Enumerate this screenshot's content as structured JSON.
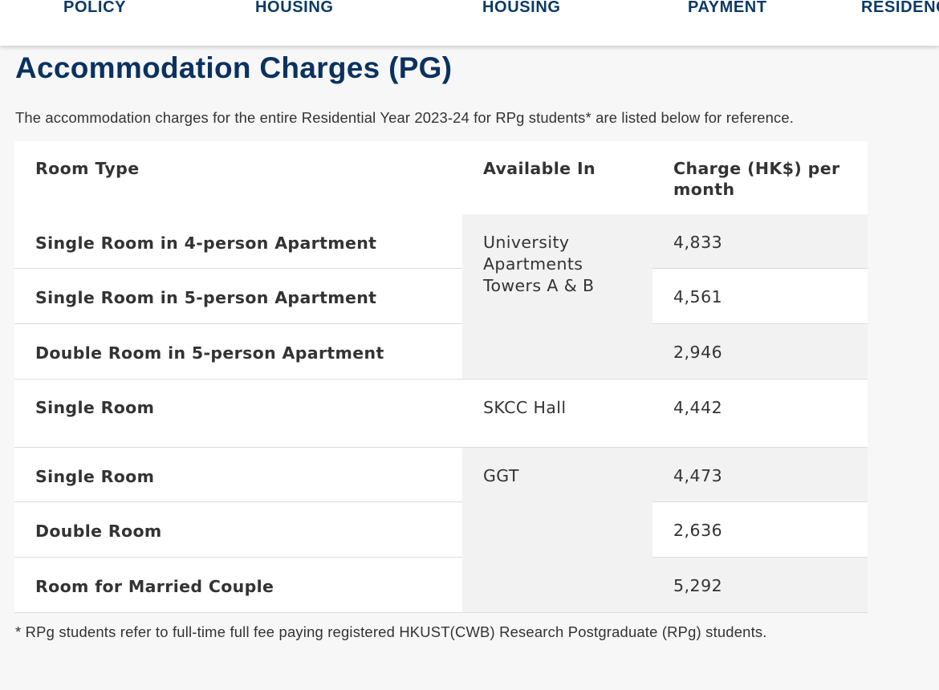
{
  "nav": {
    "items": [
      "POLICY",
      "HOUSING",
      "HOUSING",
      "PAYMENT",
      "RESIDENC"
    ]
  },
  "page": {
    "title": "Accommodation Charges (PG)",
    "intro": "The accommodation charges for the entire Residential Year 2023-24 for RPg students* are listed below for reference.",
    "footnote": "* RPg students refer to full-time full fee paying registered HKUST(CWB) Research Postgraduate (RPg) students."
  },
  "table": {
    "headers": {
      "room_type": "Room Type",
      "available_in": "Available In",
      "charge_line1": "Charge (HK$) per",
      "charge_line2": "month"
    },
    "groups": [
      {
        "location_lines": [
          "University",
          "Apartments",
          "Towers A & B"
        ],
        "rows": [
          {
            "room_type": "Single Room in 4-person Apartment",
            "charge": "4,833"
          },
          {
            "room_type": "Single Room in 5-person Apartment",
            "charge": "4,561"
          },
          {
            "room_type": "Double Room in 5-person Apartment",
            "charge": "2,946"
          }
        ]
      },
      {
        "location_lines": [
          "SKCC Hall"
        ],
        "rows": [
          {
            "room_type": "Single Room",
            "charge": "4,442"
          }
        ]
      },
      {
        "location_lines": [
          "GGT"
        ],
        "rows": [
          {
            "room_type": "Single Room",
            "charge": "4,473"
          },
          {
            "room_type": "Double Room",
            "charge": "2,636"
          },
          {
            "room_type": "Room for Married Couple",
            "charge": "5,292"
          }
        ]
      }
    ]
  },
  "colors": {
    "nav_text": "#0a3a66",
    "title": "#0a3260",
    "body_text": "#333333",
    "page_bg": "#f7f7f7",
    "cell_white": "#ffffff",
    "cell_grey": "#f2f2f2"
  }
}
